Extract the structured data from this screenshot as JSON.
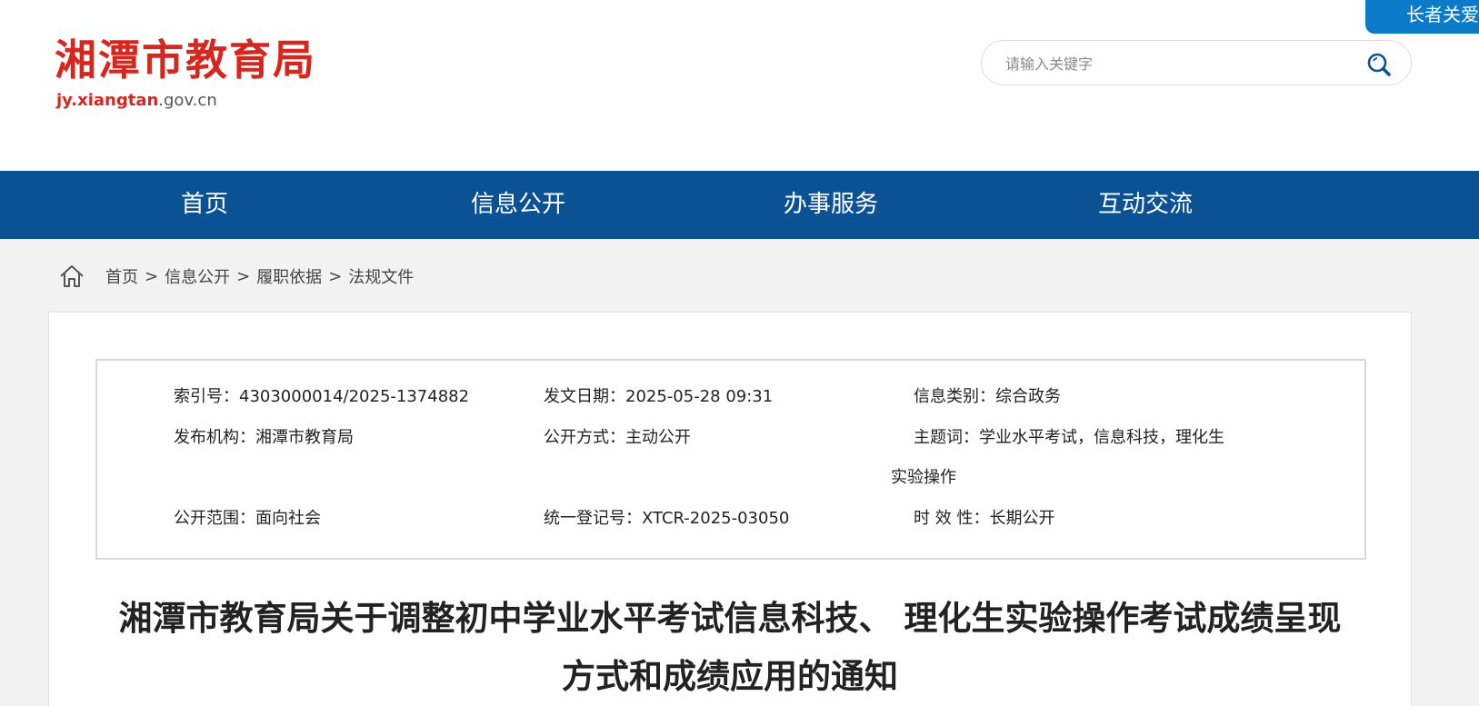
{
  "site": {
    "name": "湘潭市教育局",
    "domain_bold": "jy.xiangtan",
    "domain_rest": ".gov.cn"
  },
  "search": {
    "placeholder": "请输入关键字",
    "icon": "search-icon"
  },
  "elder_mode": {
    "label": "长者关爱"
  },
  "nav": {
    "items": [
      {
        "label": "首页"
      },
      {
        "label": "信息公开"
      },
      {
        "label": "办事服务"
      },
      {
        "label": "互动交流"
      }
    ]
  },
  "breadcrumb": {
    "home_icon": "home-icon",
    "separator": ">",
    "items": [
      {
        "label": "首页"
      },
      {
        "label": "信息公开"
      },
      {
        "label": "履职依据"
      },
      {
        "label": "法规文件"
      }
    ]
  },
  "meta": {
    "index_no": "索引号：4303000014/2025-1374882",
    "publish_date": "发文日期：2025-05-28 09:31",
    "category": "信息类别：综合政务",
    "publisher": "发布机构：湘潭市教育局",
    "disclosure_method": "公开方式：主动公开",
    "keywords_line1": "主题词：学业水平考试，信息科技，理化生",
    "keywords_line2": "实验操作",
    "disclosure_scope": "公开范围：面向社会",
    "registration_no": "统一登记号：XTCR-2025-03050",
    "validity": "时 效 性：长期公开"
  },
  "article": {
    "title": "湘潭市教育局关于调整初中学业水平考试信息科技、 理化生实验操作考试成绩呈现方式和成绩应用的通知"
  },
  "colors": {
    "brand_red": "#d7261d",
    "nav_blue": "#0b5294",
    "elder_blue": "#0b7ac8",
    "page_bg": "#f2f2f2"
  }
}
